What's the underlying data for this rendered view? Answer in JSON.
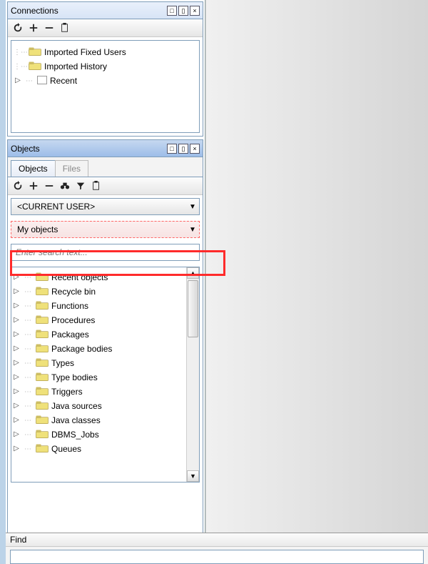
{
  "connections": {
    "title": "Connections",
    "items": [
      {
        "label": "Imported Fixed Users",
        "icon": "folder",
        "expandable": false
      },
      {
        "label": "Imported History",
        "icon": "folder",
        "expandable": false
      },
      {
        "label": "Recent",
        "icon": "box",
        "expandable": true
      }
    ]
  },
  "objects": {
    "title": "Objects",
    "tabs": [
      {
        "label": "Objects",
        "active": true
      },
      {
        "label": "Files",
        "active": false
      }
    ],
    "user_dropdown": "<CURRENT USER>",
    "filter_dropdown": "My objects",
    "search_placeholder": "Enter search text...",
    "items": [
      "Recent objects",
      "Recycle bin",
      "Functions",
      "Procedures",
      "Packages",
      "Package bodies",
      "Types",
      "Type bodies",
      "Triggers",
      "Java sources",
      "Java classes",
      "DBMS_Jobs",
      "Queues"
    ]
  },
  "find": {
    "label": "Find"
  },
  "icons": {
    "refresh": "↻",
    "plus": "+",
    "minus": "−",
    "paste": "📋",
    "search": "🔍",
    "filter": "⚙"
  },
  "colors": {
    "highlight": "#ff2b2b"
  }
}
